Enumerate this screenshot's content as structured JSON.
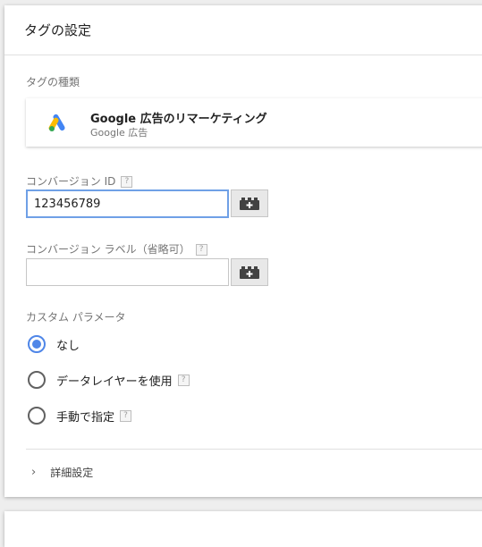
{
  "header": {
    "title": "タグの設定"
  },
  "tag_type": {
    "label": "タグの種類",
    "name": "Google 広告のリマーケティング",
    "provider": "Google 広告",
    "icon": "google-ads-logo"
  },
  "conversion_id": {
    "label": "コンバージョン ID",
    "help": "?",
    "value": "123456789"
  },
  "conversion_label": {
    "label": "コンバージョン ラベル（省略可）",
    "help": "?",
    "value": ""
  },
  "custom_params": {
    "label": "カスタム パラメータ",
    "options": [
      {
        "label": "なし",
        "checked": true
      },
      {
        "label": "データレイヤーを使用",
        "help": "?",
        "checked": false
      },
      {
        "label": "手動で指定",
        "help": "?",
        "checked": false
      }
    ]
  },
  "advanced": {
    "label": "詳細設定"
  },
  "colors": {
    "accent": "#4f86e8",
    "focus_border": "#6fa0e6"
  }
}
